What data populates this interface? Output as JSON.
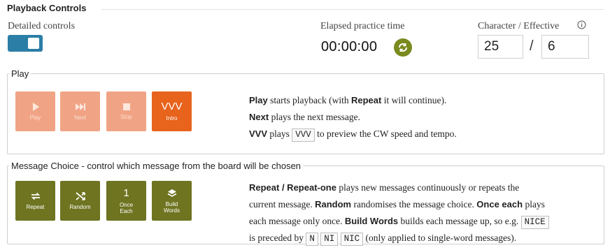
{
  "section": {
    "title": "Playback Controls"
  },
  "detailed": {
    "label": "Detailed controls",
    "on": true
  },
  "elapsed": {
    "label": "Elapsed practice time",
    "value": "00:00:00",
    "reset_icon": "refresh-icon"
  },
  "speed": {
    "label": "Character / Effective",
    "info_icon": "info-icon",
    "character": "25",
    "separator": "/",
    "effective": "6"
  },
  "play": {
    "legend": "Play",
    "buttons": [
      {
        "label": "Play",
        "icon": "play-icon"
      },
      {
        "label": "Next",
        "icon": "next-icon"
      },
      {
        "label": "Stop",
        "icon": "stop-icon"
      },
      {
        "label": "Intro",
        "glyph": "VVV"
      }
    ],
    "help": {
      "l1_b1": "Play",
      "l1_t1": " starts playback (with ",
      "l1_b2": "Repeat",
      "l1_t2": " it will continue).",
      "l2_b1": "Next",
      "l2_t1": " plays the next message.",
      "l3_b1": "VVV",
      "l3_t1": " plays ",
      "l3_code": "VVV",
      "l3_t2": " to preview the CW speed and tempo."
    }
  },
  "message": {
    "legend": "Message Choice - control which message from the board will be chosen",
    "buttons": [
      {
        "label": "Repeat",
        "icon": "repeat-icon"
      },
      {
        "label": "Random",
        "icon": "shuffle-icon"
      },
      {
        "label_line1": "Once",
        "label_line2": "Each",
        "glyph": "1"
      },
      {
        "label_line1": "Build",
        "label_line2": "Words",
        "icon": "layers-icon"
      }
    ],
    "help": {
      "b1": "Repeat / Repeat-one",
      "t1": " plays new messages continuously or repeats the",
      "t2": "current message. ",
      "b2": "Random",
      "t3": " randomises the message choice. ",
      "b3": "Once each",
      "t4": " plays",
      "t5": "each message only once. ",
      "b4": "Build Words",
      "t6": " builds each message up, so e.g. ",
      "c1": "NICE",
      "t7": "is preceded by ",
      "c2": "N",
      "c3": "NI",
      "c4": "NIC",
      "t8": " (only applied to single-word messages)."
    }
  },
  "colors": {
    "toggle": "#2b7ea6",
    "play_light": "#f1a485",
    "intro": "#e8631c",
    "olive": "#6e7420",
    "reset": "#7a8a1e"
  }
}
